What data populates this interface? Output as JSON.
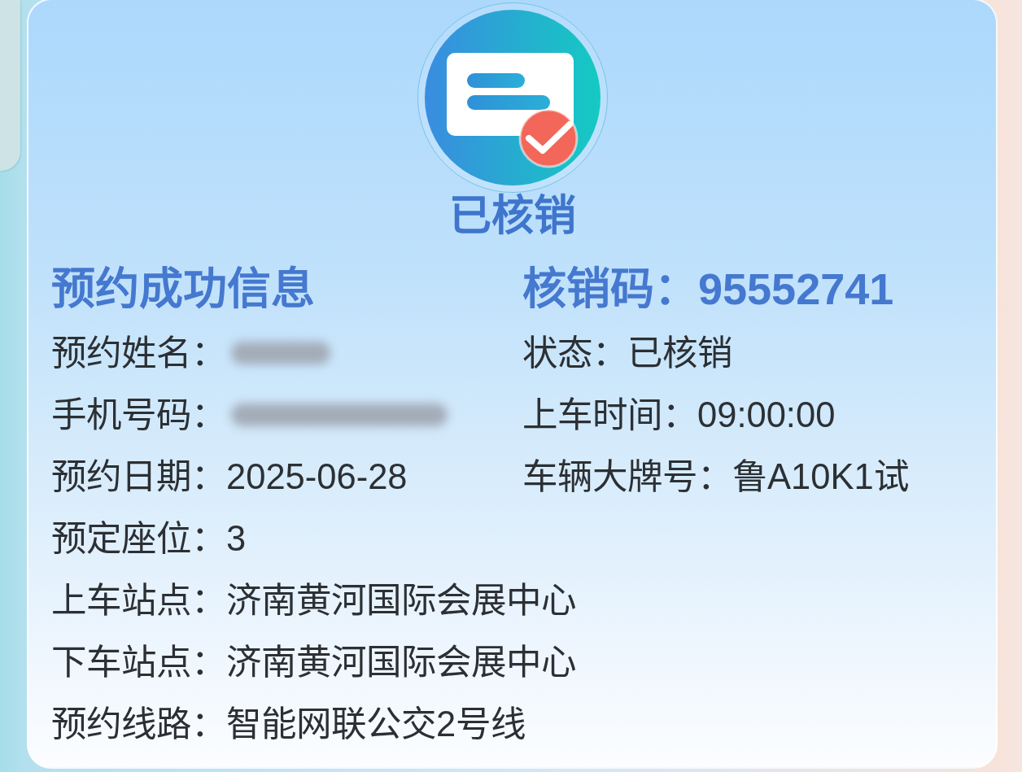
{
  "status_title": "已核销",
  "info_heading": "预约成功信息",
  "verification_code": "核销码：95552741",
  "left_fields": [
    {
      "label": "预约姓名：",
      "kind": "blurred"
    },
    {
      "label": "手机号码：",
      "kind": "blurred"
    },
    {
      "label": "预约日期：",
      "kind": "text",
      "value": "2025-06-28"
    },
    {
      "label": "预定座位：",
      "kind": "text",
      "value": "3"
    },
    {
      "label": "上车站点：",
      "kind": "text",
      "value": "济南黄河国际会展中心"
    },
    {
      "label": "下车站点：",
      "kind": "text",
      "value": "济南黄河国际会展中心"
    },
    {
      "label": "预约线路：",
      "kind": "text",
      "value": "智能网联公交2号线"
    }
  ],
  "right_fields": [
    {
      "label": "状态：",
      "kind": "text",
      "value": "已核销"
    },
    {
      "label": "上车时间：",
      "kind": "text",
      "value": "09:00:00"
    },
    {
      "label": "车辆大牌号：",
      "kind": "text",
      "value": "鲁A10K1试"
    }
  ]
}
